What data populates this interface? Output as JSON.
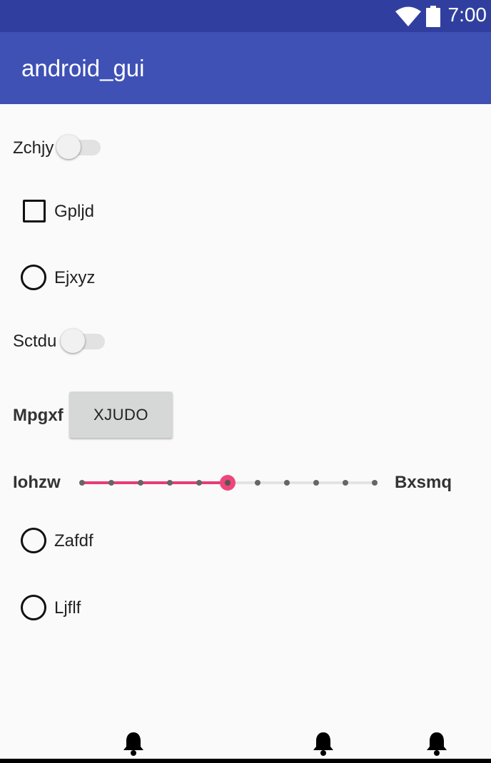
{
  "status_bar": {
    "time": "7:00",
    "icons": [
      "wifi-icon",
      "battery-icon"
    ]
  },
  "app_bar": {
    "title": "android_gui"
  },
  "controls": {
    "switch1": {
      "label": "Zchjy",
      "checked": false
    },
    "checkbox1": {
      "label": "Gpljd",
      "checked": false
    },
    "radio1": {
      "label": "Ejxyz",
      "checked": false
    },
    "switch2": {
      "label": "Sctdu",
      "checked": false
    },
    "button_row": {
      "label": "Mpgxf",
      "button": "XJUDO"
    },
    "slider": {
      "min_label": "Iohzw",
      "max_label": "Bxsmq",
      "steps": 10,
      "value_index": 5
    },
    "radio2": {
      "label": "Zafdf",
      "checked": false
    },
    "radio3": {
      "label": "Ljflf",
      "checked": false
    }
  },
  "bottom_bar": {
    "icons": [
      "bell-icon",
      "bell-icon",
      "bell-icon"
    ]
  },
  "colors": {
    "status_bar": "#303f9f",
    "app_bar": "#3f51b5",
    "accent": "#e91e63",
    "background": "#fafafa"
  }
}
